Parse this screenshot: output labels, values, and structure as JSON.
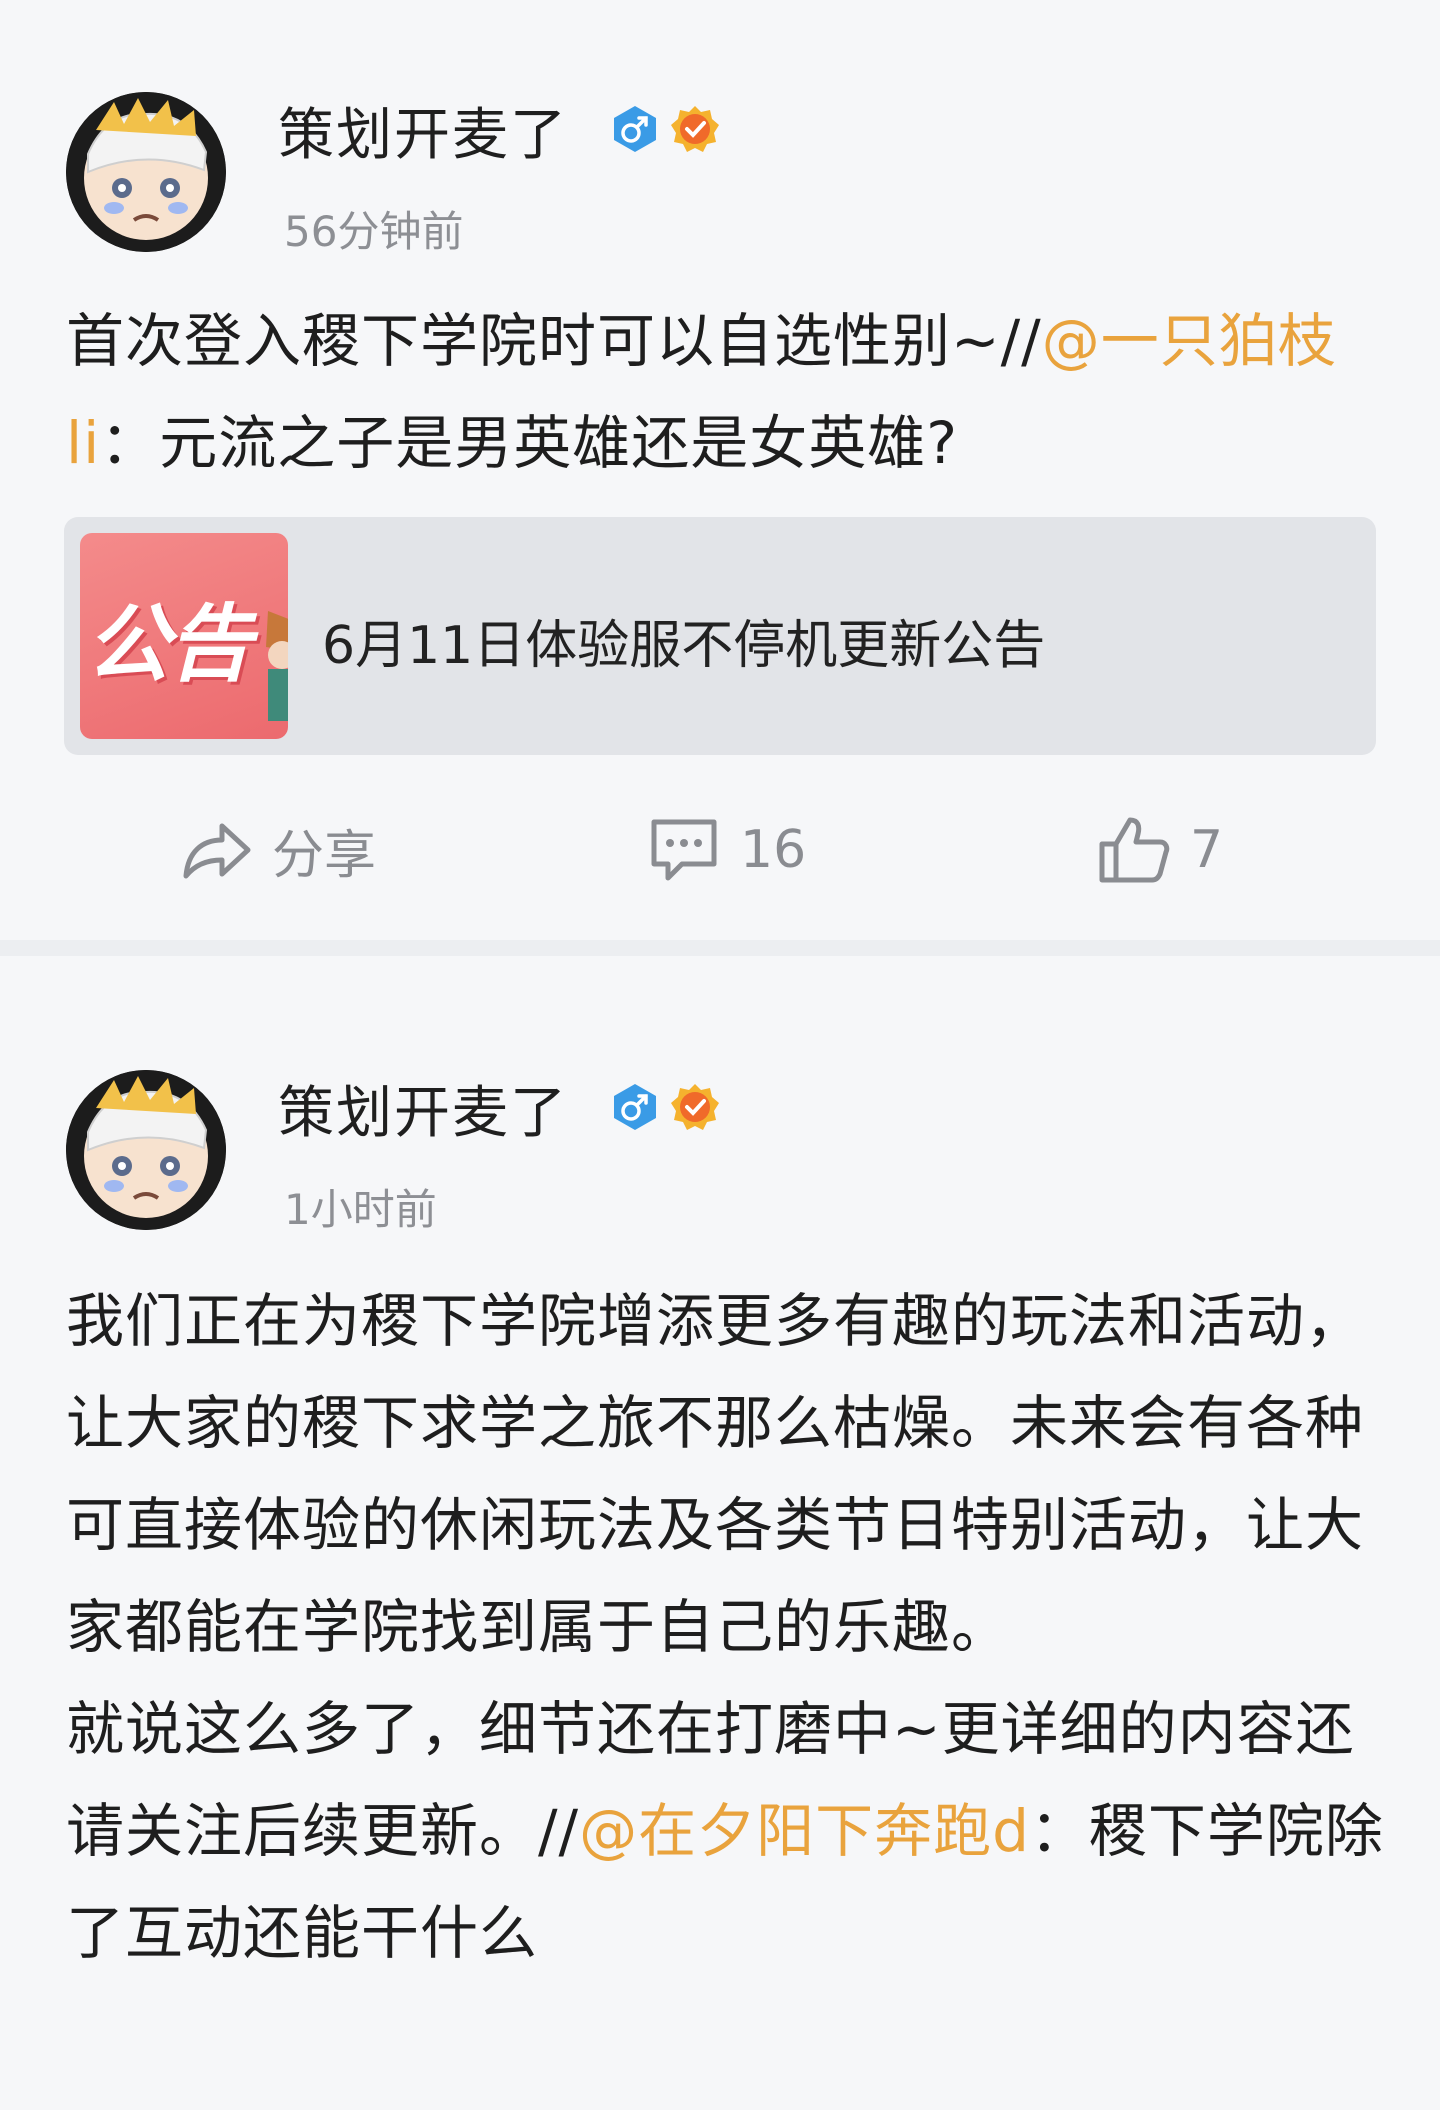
{
  "posts": [
    {
      "author": "策划开麦了",
      "time": "56分钟前",
      "gender_icon": "male-icon",
      "verified_icon": "verified-badge-icon",
      "body_text": "首次登入稷下学院时可以自选性别~//",
      "mention": "@一只狛枝li",
      "quote_text": "：元流之子是男英雄还是女英雄?",
      "card": {
        "thumb_text": "公告",
        "title": "6月11日体验服不停机更新公告"
      },
      "actions": {
        "share_label": "分享",
        "comment_count": "16",
        "like_count": "7"
      }
    },
    {
      "author": "策划开麦了",
      "time": "1小时前",
      "gender_icon": "male-icon",
      "verified_icon": "verified-badge-icon",
      "para1": "我们正在为稷下学院增添更多有趣的玩法和活动，让大家的稷下求学之旅不那么枯燥。未来会有各种可直接体验的休闲玩法及各类节日特别活动，让大家都能在学院找到属于自己的乐趣。",
      "para2": "就说这么多了，细节还在打磨中~更详细的内容还请关注后续更新。//",
      "mention": "@在夕阳下奔跑d",
      "quote_text": "：稷下学院除了互动还能干什么"
    }
  ],
  "colors": {
    "mention": "#e9a33d",
    "gender_badge": "#3a9be6",
    "verified_badge": "#f06a2a",
    "muted": "#8d8f94",
    "card_bg": "#e2e4e8"
  }
}
